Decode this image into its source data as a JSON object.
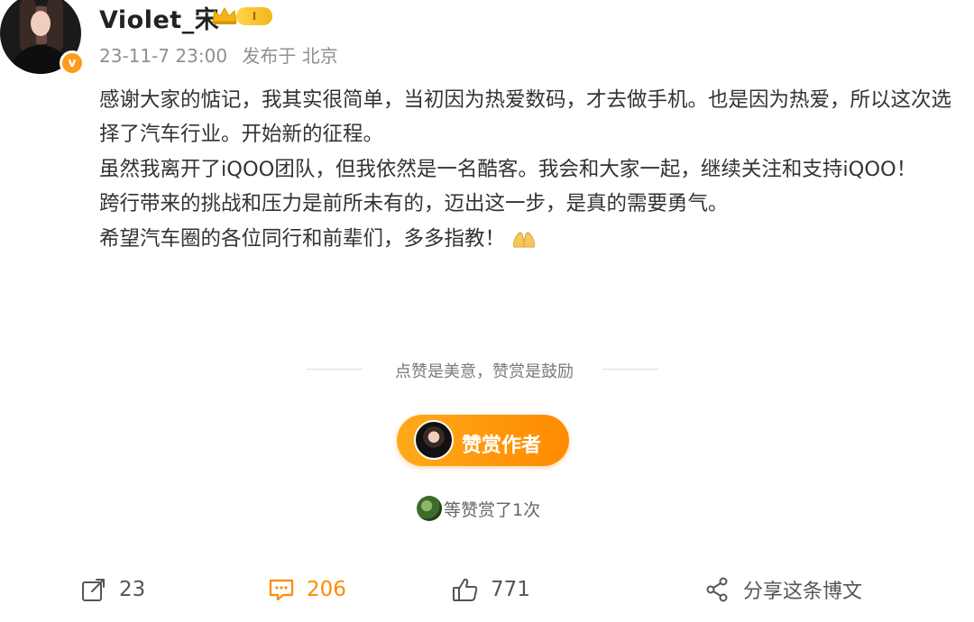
{
  "author": {
    "name": "Violet_宋",
    "verified_icon": "verified-v-icon",
    "verified_mark": "v",
    "level_icon": "crown-level-icon",
    "level_label": "I"
  },
  "post": {
    "date": "23-11-7 23:00",
    "location": "发布于 北京",
    "paragraphs": [
      "感谢大家的惦记，我其实很简单，当初因为热爱数码，才去做手机。也是因为热爱，所以这次选择了汽车行业。开始新的征程。",
      "虽然我离开了iQOO团队，但我依然是一名酷客。我会和大家一起，继续关注和支持iQOO！",
      "跨行带来的挑战和压力是前所未有的，迈出这一步，是真的需要勇气。",
      "希望汽车圈的各位同行和前辈们，多多指教！"
    ],
    "emoji": "praying-hands-icon"
  },
  "reward": {
    "divider_text": "点赞是美意，赞赏是鼓励",
    "button_label": "赞赏作者",
    "count_text": "等赞赏了1次"
  },
  "actions": {
    "repost_count": "23",
    "comment_count": "206",
    "like_count": "771",
    "share_label": "分享这条博文"
  },
  "colors": {
    "accent": "#ff8a00",
    "text": "#333333",
    "muted": "#8f8f8f"
  }
}
